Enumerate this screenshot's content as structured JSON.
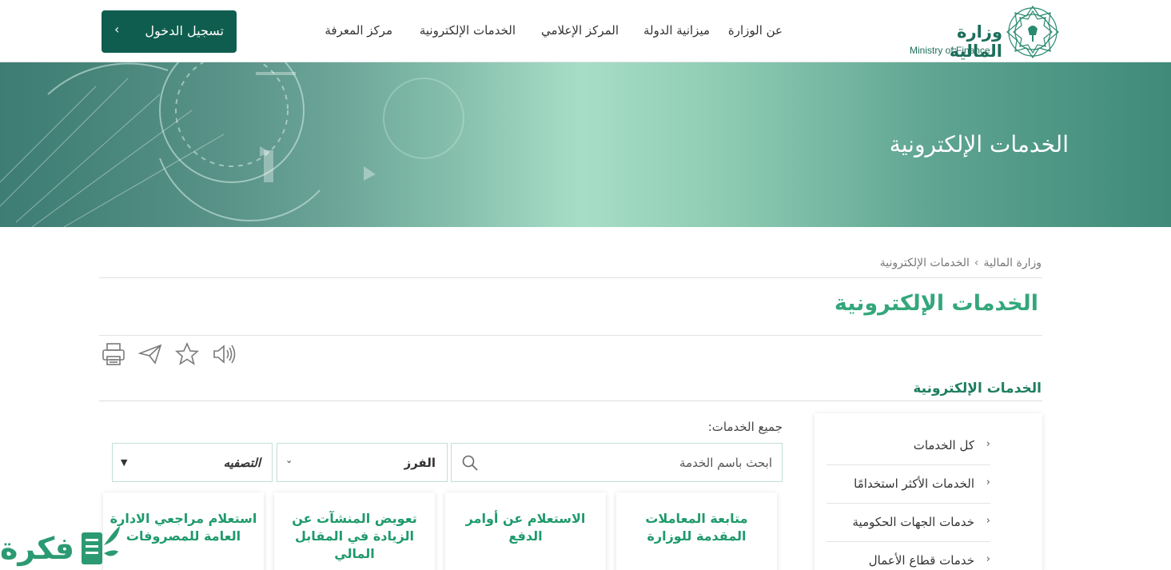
{
  "header": {
    "logo_ar": "وزارة المالية",
    "logo_en": "Ministry of Finance",
    "nav": [
      "عن الوزارة",
      "ميزانية الدولة",
      "المركز الإعلامي",
      "الخدمات الإلكترونية",
      "مركز المعرفة"
    ],
    "login_label": "تسجيل الدخول",
    "login_chevron": "›"
  },
  "banner": {
    "title": "الخدمات الإلكترونية"
  },
  "breadcrumb": {
    "home": "وزارة المالية",
    "sep": "›",
    "current": "الخدمات الإلكترونية"
  },
  "page_title": "الخدمات الإلكترونية",
  "tools": [
    "printer-icon",
    "send-icon",
    "star-icon",
    "speaker-icon"
  ],
  "section_title": "الخدمات الإلكترونية",
  "sidebar": {
    "items": [
      "كل الخدمات",
      "الخدمات الأكثر استخدامًا",
      "خدمات الجهات الحكومية",
      "خدمات قطاع الأعمال"
    ],
    "chevron": "‹"
  },
  "filters": {
    "label": "جميع الخدمات:",
    "search_placeholder": "ابحث باسم الخدمة",
    "sort_value": "الفرز",
    "filter_value": "التصفيه",
    "arrow": "▼"
  },
  "cards": [
    {
      "title": "متابعة المعاملات المقدمة للوزارة"
    },
    {
      "title": "الاستعلام عن أوامر الدفع"
    },
    {
      "title": "تعويض المنشآت عن الزيادة في المقابل المالي"
    },
    {
      "title": "استعلام مراجعي الادارة العامة للمصروفات"
    }
  ],
  "watermark": {
    "text": "فكرة"
  },
  "colors": {
    "primary": "#0f5d4e",
    "accent": "#34a77b",
    "card_title": "#1f9a6c"
  }
}
